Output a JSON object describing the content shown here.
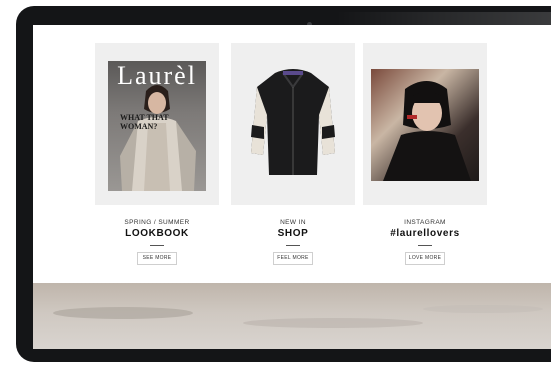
{
  "cards": [
    {
      "subtitle": "SPRING / SUMMER",
      "title": "LOOKBOOK",
      "button": "SEE MORE",
      "cover": {
        "masthead": "Laurèl",
        "headline": "WHAT THAT WOMAN?"
      }
    },
    {
      "subtitle": "NEW IN",
      "title": "SHOP",
      "button": "FEEL MORE"
    },
    {
      "subtitle": "INSTAGRAM",
      "title": "#laurellovers",
      "button": "LOVE MORE"
    }
  ],
  "icons": {
    "jacket": "leather-jacket",
    "portrait": "woman-portrait"
  }
}
